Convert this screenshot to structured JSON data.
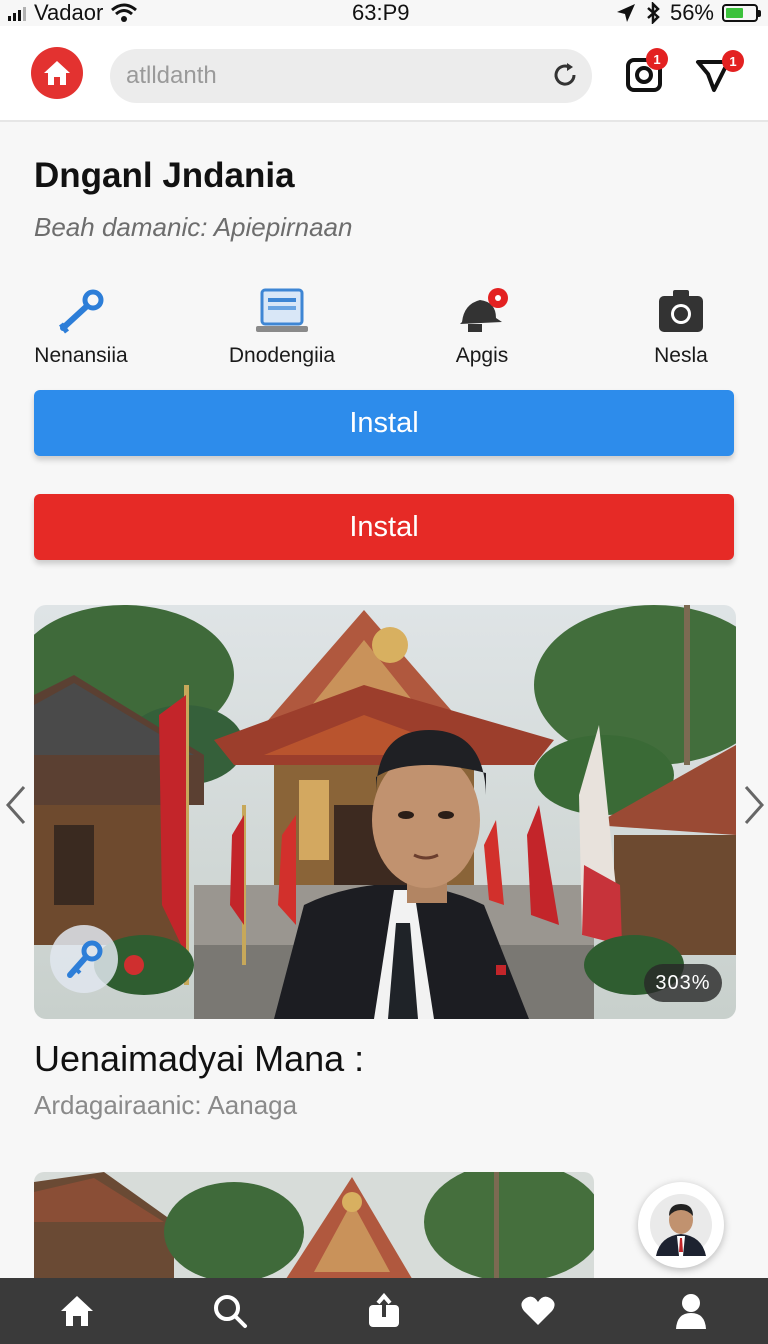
{
  "status_bar": {
    "carrier": "Vadaor",
    "time": "63:P9",
    "battery": "56%",
    "battery_level": 0.56,
    "battery_color": "#3cc23c"
  },
  "header": {
    "search_placeholder": "atlldanth",
    "camera_badge": "1",
    "cart_badge": "1",
    "accent": "#e33230"
  },
  "hero": {
    "title": "Dnganl Jndania",
    "subtitle": "Beah damanic: Apiepirnaan"
  },
  "quick_actions": [
    {
      "label": "Nenansiia",
      "icon": "wrench-icon"
    },
    {
      "label": "Dnodengiia",
      "icon": "laptop-icon"
    },
    {
      "label": "Apgis",
      "icon": "notification-bell-icon"
    },
    {
      "label": "Nesla",
      "icon": "camera-icon"
    }
  ],
  "buttons": {
    "primary_label": "Instal",
    "secondary_label": "Instal",
    "primary_color": "#2d8ceb",
    "secondary_color": "#e62a26"
  },
  "carousel": {
    "counter": "303%"
  },
  "card": {
    "title": "Uenaimadyai Mana :",
    "subtitle": "Ardagairaanic: Aanaga"
  },
  "bottom_nav": [
    {
      "icon": "home-icon"
    },
    {
      "icon": "search-icon"
    },
    {
      "icon": "upload-icon"
    },
    {
      "icon": "heart-icon"
    },
    {
      "icon": "profile-icon"
    }
  ]
}
